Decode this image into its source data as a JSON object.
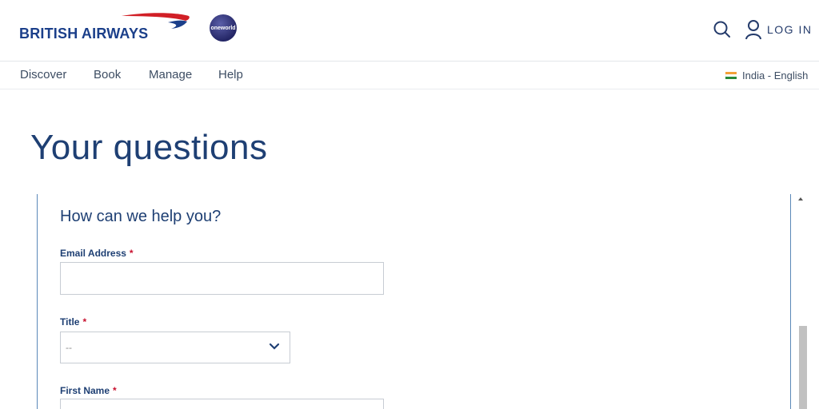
{
  "brand": {
    "name": "BRITISH AIRWAYS",
    "alliance": "oneworld"
  },
  "header": {
    "login_label": "LOG IN",
    "icons": [
      "search-icon",
      "user-icon"
    ]
  },
  "nav": {
    "items": [
      {
        "label": "Discover"
      },
      {
        "label": "Book"
      },
      {
        "label": "Manage"
      },
      {
        "label": "Help"
      }
    ],
    "locale": "India - English"
  },
  "page": {
    "title": "Your questions"
  },
  "form": {
    "heading": "How can we help you?",
    "required_mark": "*",
    "email": {
      "label": "Email Address",
      "value": ""
    },
    "title": {
      "label": "Title",
      "selected": "--"
    },
    "first_name": {
      "label": "First Name",
      "value": ""
    }
  },
  "colors": {
    "brand_navy": "#1e3f73",
    "required": "#c8102e",
    "ribbon_red": "#d11f26",
    "ribbon_blue": "#1b3f8a"
  }
}
